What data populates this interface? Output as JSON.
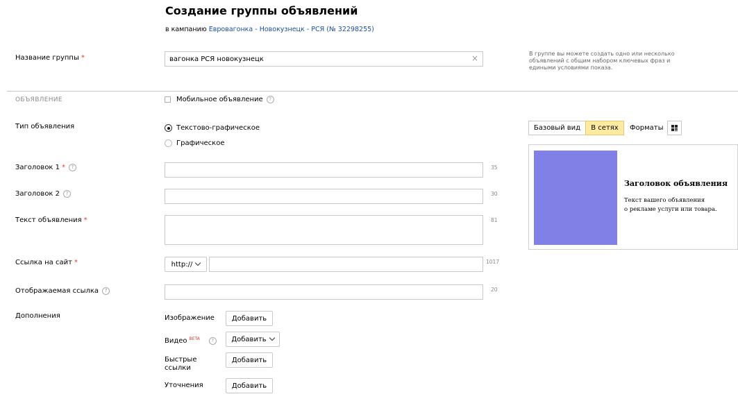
{
  "header": {
    "title": "Создание группы объявлений",
    "subtitle_prefix": "в кампанию",
    "campaign_link": "Евровагонка - Новокузнецк - РСЯ (№ 32298255)"
  },
  "group": {
    "label": "Название группы",
    "required_mark": "*",
    "value": "вагонка РСЯ новокузнецк",
    "clear_icon": "×",
    "hint": "В группе вы можете создать одно или несколько объявлений с общим набором ключевых фраз и едиными условиями показа."
  },
  "section": {
    "title": "ОБЪЯВЛЕНИЕ",
    "mobile_label": "Мобильное объявление"
  },
  "ad_type": {
    "label": "Тип объявления",
    "options": [
      "Текстово-графическое",
      "Графическое"
    ]
  },
  "fields": {
    "headline1": {
      "label": "Заголовок 1",
      "counter": "35"
    },
    "headline2": {
      "label": "Заголовок 2",
      "counter": "30"
    },
    "text": {
      "label": "Текст объявления",
      "counter": "81"
    },
    "url": {
      "label": "Ссылка на сайт",
      "protocol": "http://",
      "counter": "1017"
    },
    "display_url": {
      "label": "Отображаемая ссылка",
      "counter": "20"
    }
  },
  "required_mark": "*",
  "help_icon": "?",
  "extras": {
    "label": "Дополнения",
    "image_label": "Изображение",
    "video_label": "Видео",
    "beta": "BETA",
    "quick_links_label": "Быстрые ссылки",
    "clarifications_label": "Уточнения",
    "add_button": "Добавить"
  },
  "preview_tabs": {
    "basic": "Базовый вид",
    "networks": "В сетях",
    "formats": "Форматы"
  },
  "preview": {
    "title": "Заголовок объявления",
    "text_line1": "Текст вашего объявления",
    "text_line2": "о рекламе услуги или товара.",
    "image_color": "#8080e6"
  },
  "colors": {
    "required": "#e23b2d",
    "link": "#1a4fa0",
    "active_tab": "#ffeba0"
  }
}
